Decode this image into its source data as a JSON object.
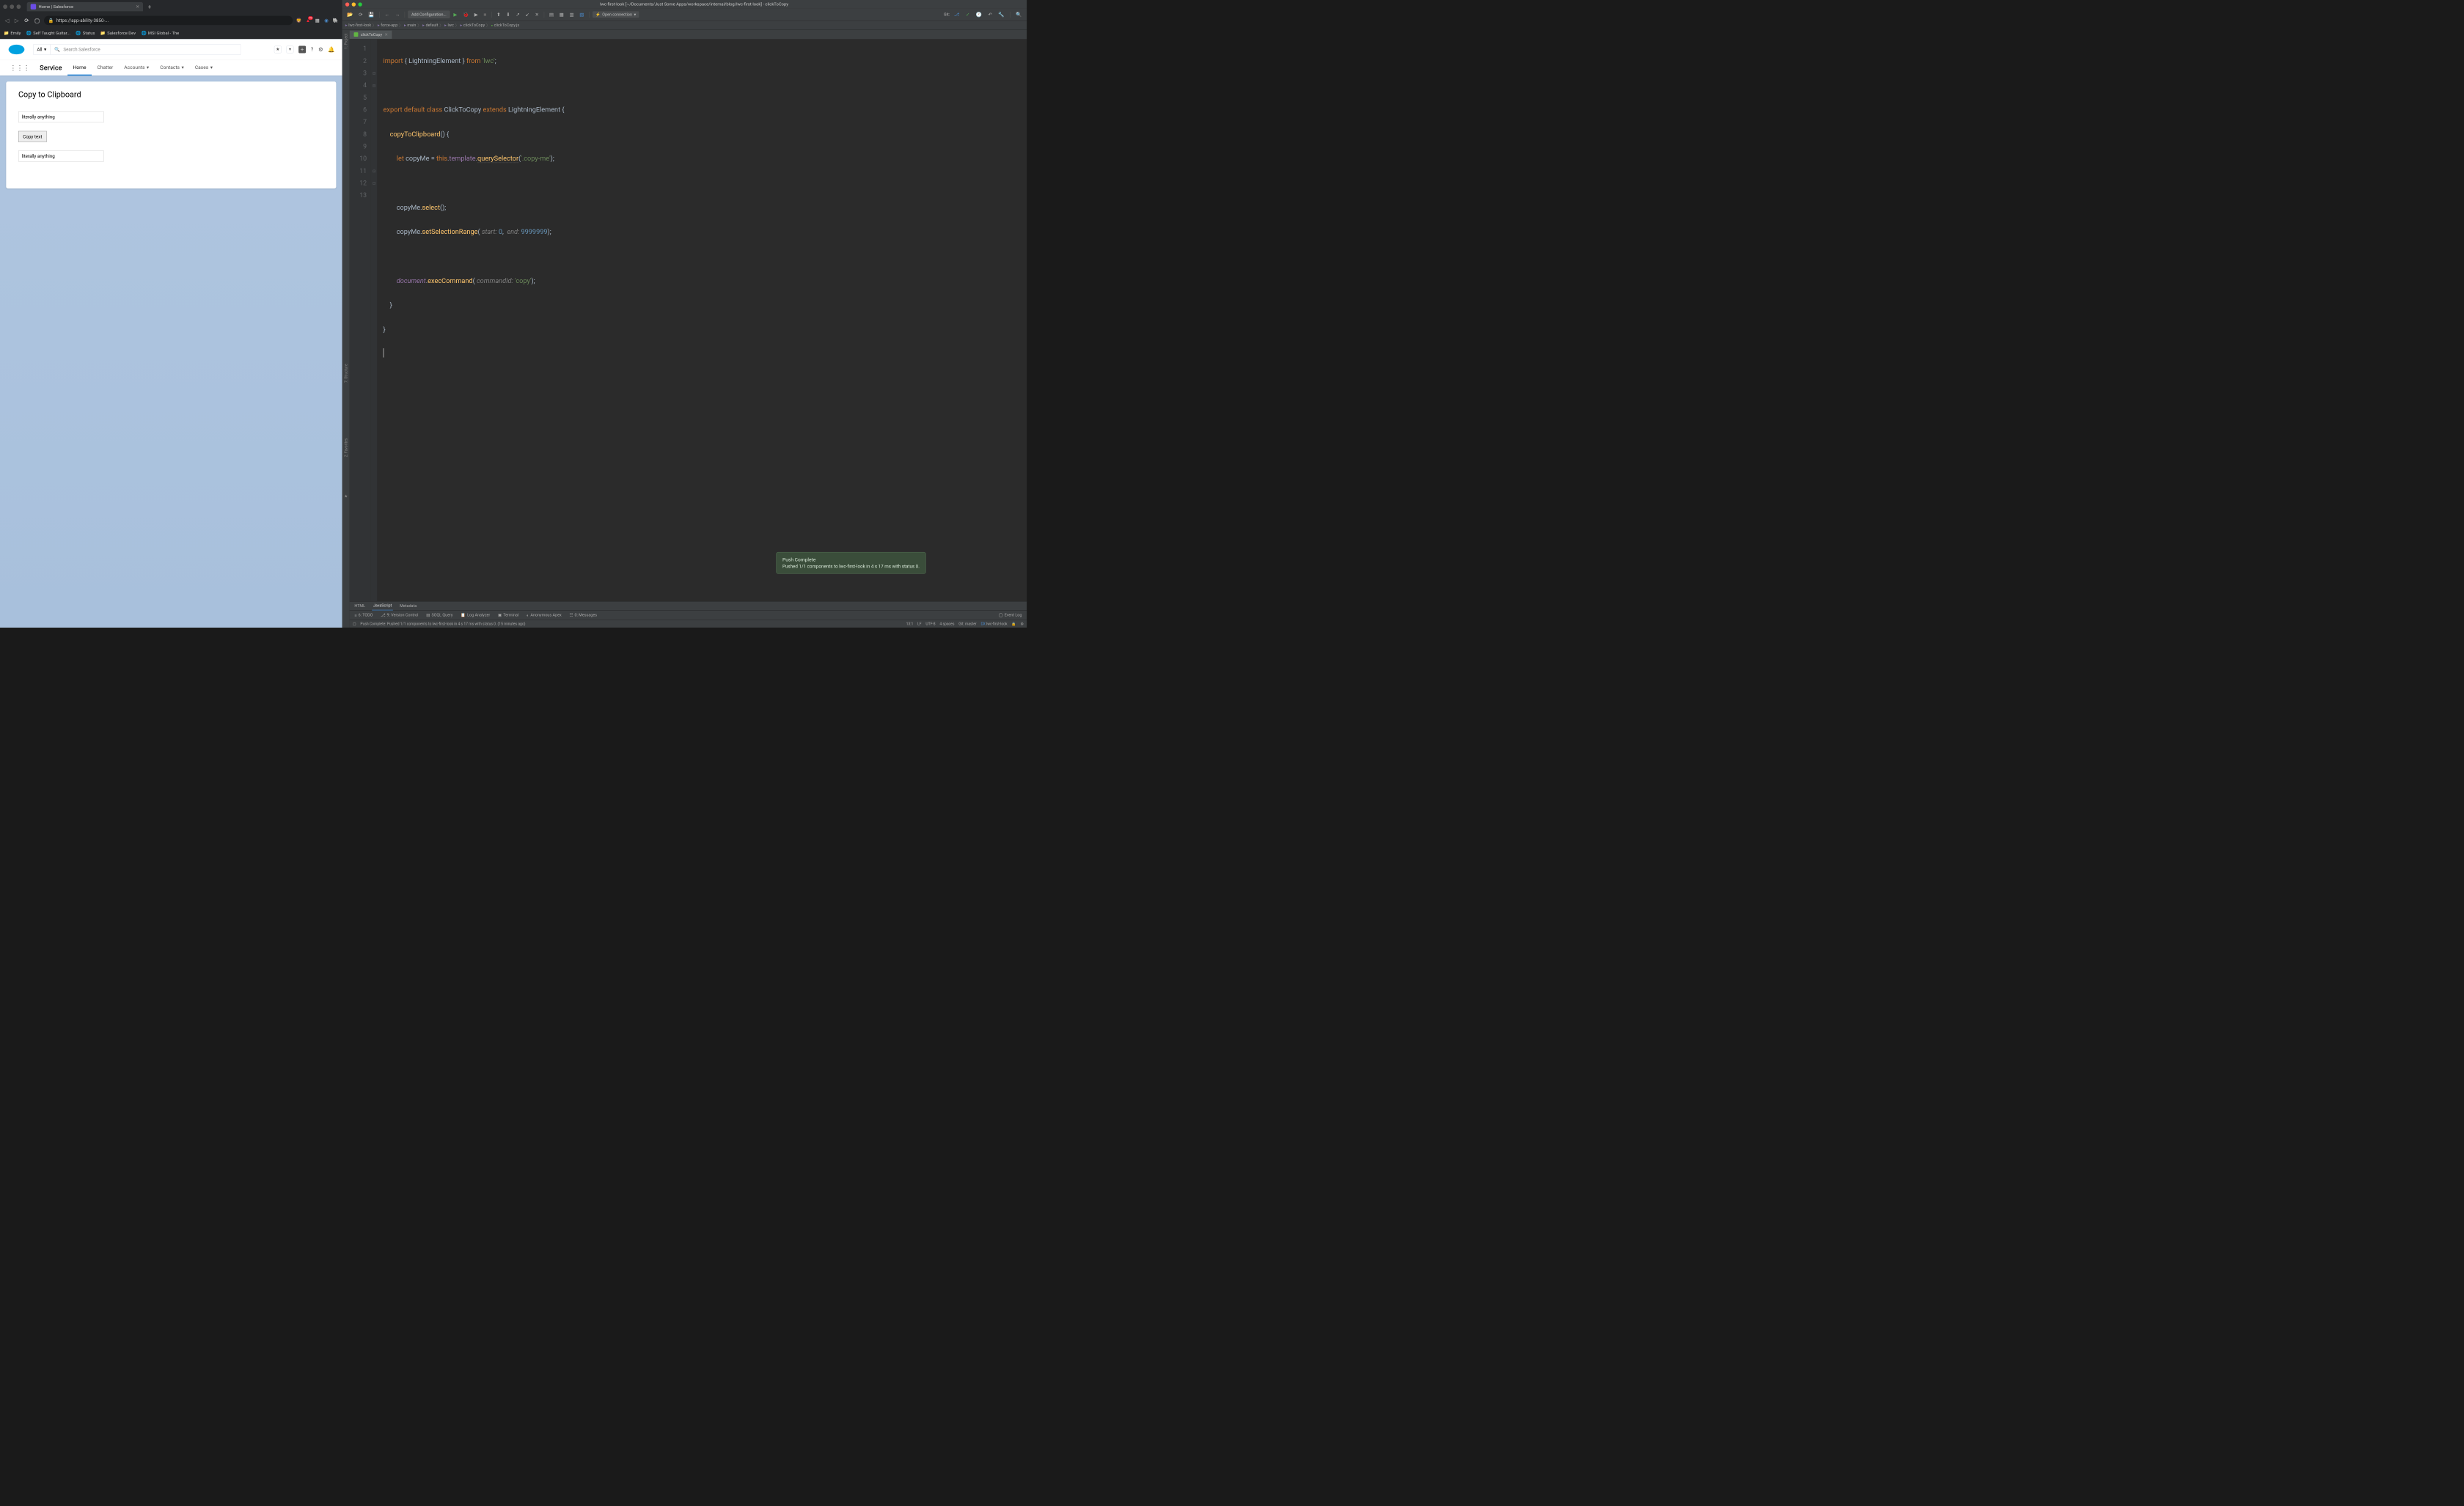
{
  "browser": {
    "tab_title": "Home | Salesforce",
    "url": "https://app-ability-3850-...",
    "badge_count": "10",
    "bookmarks": [
      "Emily",
      "Self Taught Guitar...",
      "Status",
      "Salesforce Dev",
      "MSI Global - The"
    ]
  },
  "salesforce": {
    "search_sel": "All",
    "search_placeholder": "Search Salesforce",
    "app_name": "Service",
    "nav_items": [
      "Home",
      "Chatter",
      "Accounts",
      "Contacts",
      "Cases"
    ],
    "card_title": "Copy to Clipboard",
    "input1_value": "literally anything",
    "button_label": "Copy text",
    "input2_value": "literally anything"
  },
  "ide": {
    "title": "lwc-first-look [~/Documents/Just Some Apps/workspace/internal/blog/lwc-first-look] - clickToCopy",
    "config_select": "Add Configuration...",
    "open_connection": "Open connection",
    "git_label": "Git:",
    "breadcrumb": [
      "lwc-first-look",
      "force-app",
      "main",
      "default",
      "lwc",
      "clickToCopy",
      "clickToCopy.js"
    ],
    "tab_name": "clickToCopy",
    "left_tabs": [
      "1: Project",
      "7: Structure",
      "2: Favorites"
    ],
    "line_numbers": [
      "1",
      "2",
      "3",
      "4",
      "5",
      "6",
      "7",
      "8",
      "9",
      "10",
      "11",
      "12",
      "13"
    ],
    "code": {
      "l1": {
        "import": "import",
        "brace1": " { ",
        "name": "LightningElement",
        "brace2": " } ",
        "from": "from ",
        "mod": "'lwc'",
        "semi": ";"
      },
      "l3": {
        "export": "export ",
        "default": "default ",
        "class": "class ",
        "name": "ClickToCopy ",
        "extends": "extends ",
        "parent": "LightningElement ",
        "brace": "{"
      },
      "l4": {
        "indent": "    ",
        "fn": "copyToClipboard",
        "paren": "() {",
        "rest": ""
      },
      "l5": {
        "indent": "        ",
        "let": "let ",
        "var": "copyMe ",
        "eq": "= ",
        "this": "this",
        "dot1": ".",
        "tpl": "template",
        "dot2": ".",
        "qs": "querySelector",
        "open": "(",
        "str": "'.copy-me'",
        "close": ");"
      },
      "l7": {
        "indent": "        ",
        "var": "copyMe",
        "dot": ".",
        "fn": "select",
        "paren": "();"
      },
      "l8": {
        "indent": "        ",
        "var": "copyMe",
        "dot": ".",
        "fn": "setSelectionRange",
        "open": "( ",
        "p1": "start: ",
        "v1": "0",
        "c": ",  ",
        "p2": "end: ",
        "v2": "9999999",
        "close": ");"
      },
      "l10": {
        "indent": "        ",
        "doc": "document",
        "dot": ".",
        "fn": "execCommand",
        "open": "( ",
        "p1": "commandId: ",
        "str": "'copy'",
        "close": ");"
      },
      "l11": {
        "indent": "    ",
        "brace": "}"
      },
      "l12": {
        "brace": "}"
      }
    },
    "bottom_tabs": [
      "HTML",
      "JavaScript",
      "Metadata"
    ],
    "bottom_tools": [
      "6: TODO",
      "9: Version Control",
      "SOQL Query",
      "Log Analyzer",
      "Terminal",
      "Anonymous Apex",
      "0: Messages"
    ],
    "event_log": "Event Log",
    "notification": {
      "title": "Push Complete",
      "body": "Pushed 1/1 components to lwc-first-look in 4 s 17 ms with status 0."
    },
    "status_message": "Push Complete: Pushed 1/1 components to lwc-first-look in 4 s 17 ms with status 0. (15 minutes ago)",
    "status_right": [
      "13:1",
      "LF",
      "UTF-8",
      "4 spaces",
      "Git: master"
    ],
    "status_dx": "lwc-first-look",
    "status_dx_prefix": "DX"
  }
}
